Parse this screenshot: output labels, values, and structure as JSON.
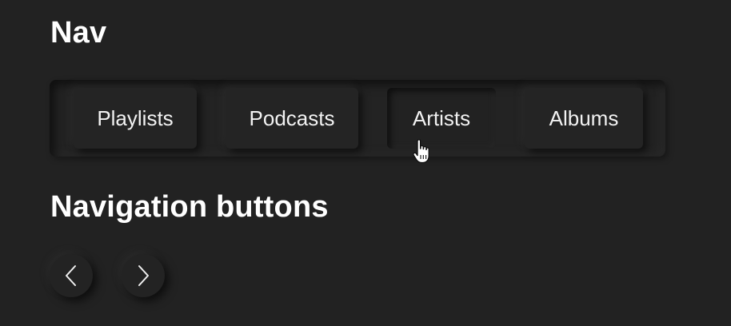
{
  "sections": {
    "nav_title": "Nav",
    "nav_buttons_title": "Navigation buttons"
  },
  "nav": {
    "items": [
      {
        "label": "Playlists"
      },
      {
        "label": "Podcasts"
      },
      {
        "label": "Artists",
        "active": true
      },
      {
        "label": "Albums"
      }
    ]
  },
  "buttons": {
    "prev_icon": "chevron-left-icon",
    "next_icon": "chevron-right-icon"
  },
  "cursor": {
    "icon": "hand-pointer-icon"
  },
  "colors": {
    "background": "#222222",
    "text": "#ffffff"
  }
}
